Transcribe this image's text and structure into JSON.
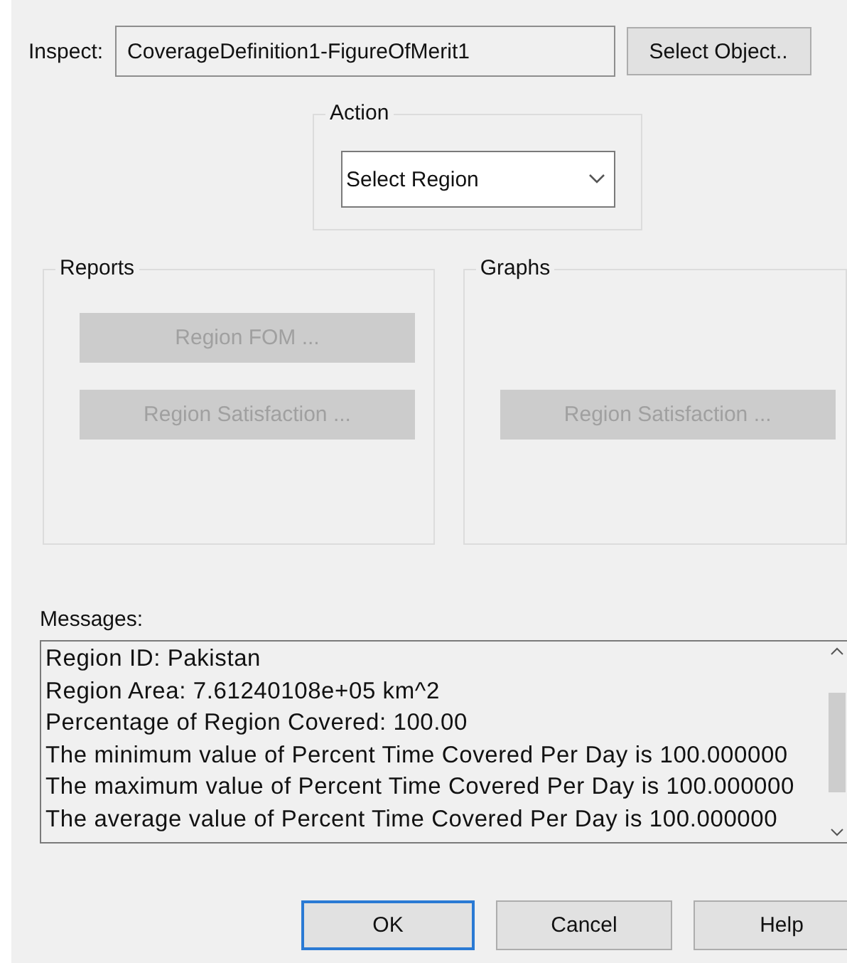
{
  "inspect": {
    "label": "Inspect:",
    "value": "CoverageDefinition1-FigureOfMerit1",
    "button": "Select Object.."
  },
  "action": {
    "title": "Action",
    "value": "Select Region"
  },
  "reports": {
    "title": "Reports",
    "buttons": [
      {
        "label": "Region FOM ...",
        "disabled": true
      },
      {
        "label": "Region Satisfaction ...",
        "disabled": true
      }
    ]
  },
  "graphs": {
    "title": "Graphs",
    "buttons": [
      {
        "label": "Region Satisfaction ...",
        "disabled": true
      }
    ]
  },
  "messages": {
    "label": "Messages:",
    "lines": [
      "Region ID: Pakistan",
      "Region Area: 7.61240108e+05 km^2",
      "Percentage of Region Covered: 100.00",
      "The minimum value of Percent Time Covered Per Day is 100.000000",
      "The maximum value of Percent Time Covered Per Day is 100.000000",
      "The average value of Percent Time Covered Per Day is 100.000000"
    ]
  },
  "buttons": [
    {
      "label": "OK",
      "default": true
    },
    {
      "label": "Cancel",
      "default": false
    },
    {
      "label": "Help",
      "default": false
    }
  ]
}
